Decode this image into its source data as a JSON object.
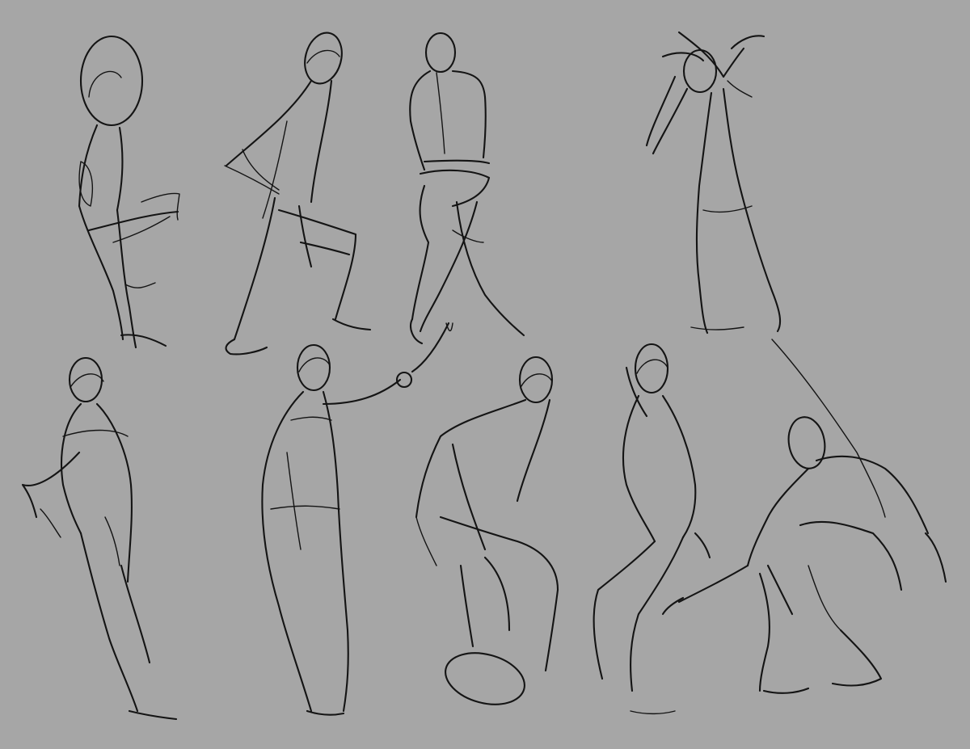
{
  "sheet": {
    "background_color": "#a6a6a6",
    "ink_color": "#141414",
    "figure_count": 9
  }
}
